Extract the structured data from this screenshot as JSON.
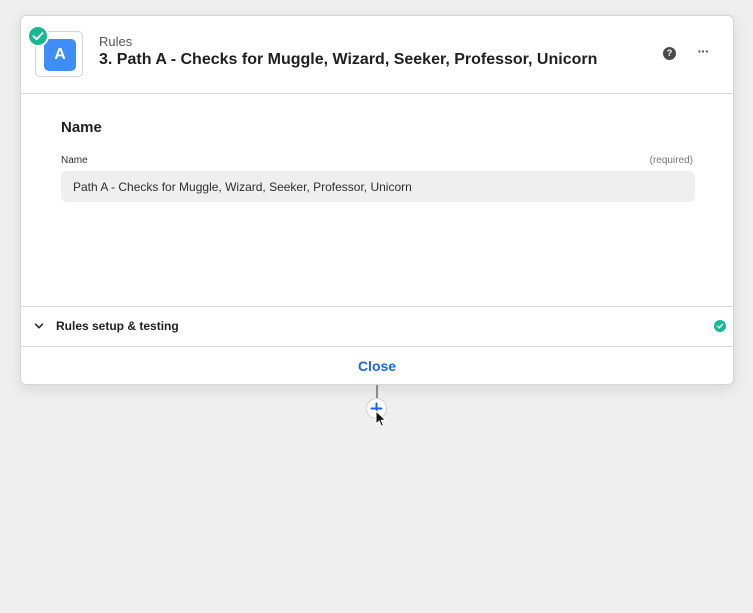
{
  "step": {
    "app_icon_letter": "A",
    "app_icon_color": "#3f8ef7",
    "app_name": "Rules",
    "title": "3. Path A - Checks for Muggle, Wizard, Seeker, Professor, Unicorn",
    "status": "complete",
    "status_color": "#17b893",
    "help_icon": "question-circle-icon",
    "more_icon": "ellipsis-horizontal-icon"
  },
  "name_section": {
    "heading": "Name",
    "field_label": "Name",
    "required_text": "(required)",
    "field_value": "Path A - Checks for Muggle, Wizard, Seeker, Professor, Unicorn"
  },
  "accordion": {
    "label": "Rules setup & testing",
    "expanded": false,
    "complete": true
  },
  "footer": {
    "close_label": "Close",
    "accent_color": "#1a65e6"
  }
}
